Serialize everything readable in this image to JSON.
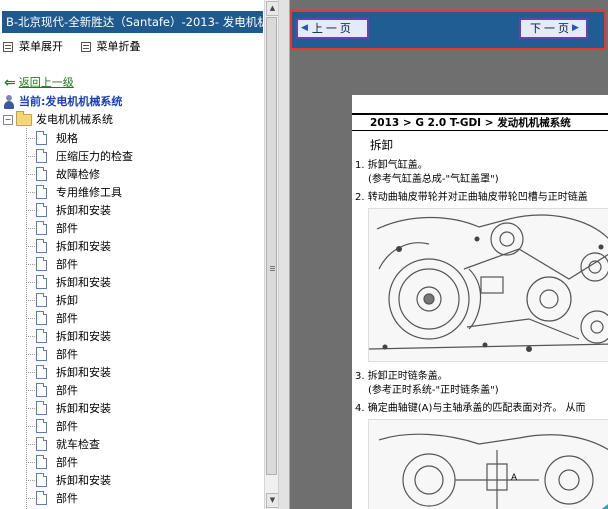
{
  "left": {
    "title": "B-北京现代-全新胜达（Santafe）-2013- 发电机机",
    "menu": {
      "expand": "菜单展开",
      "collapse": "菜单折叠"
    },
    "back_label": "返回上一级",
    "current_label": "当前:发电机机械系统",
    "tree_root": {
      "expander": "−",
      "label": "发电机机械系统"
    },
    "items": [
      "规格",
      "压缩压力的检查",
      "故障检修",
      "专用维修工具",
      "拆卸和安装",
      "部件",
      "拆卸和安装",
      "部件",
      "拆卸和安装",
      "拆卸",
      "部件",
      "拆卸和安装",
      "部件",
      "拆卸和安装",
      "部件",
      "拆卸和安装",
      "部件",
      "就车检查",
      "部件",
      "拆卸和安装",
      "部件"
    ]
  },
  "nav": {
    "prev": "上一页",
    "next": "下一页"
  },
  "document": {
    "breadcrumb": "2013 > G 2.0 T-GDI > 发动机机械系统",
    "section": "拆卸",
    "steps": [
      "1. 拆卸气缸盖。",
      "   (参考气缸盖总成-\"气缸盖罩\")",
      "2. 转动曲轴皮带轮并对正曲轴皮带轮凹槽与正时链盖",
      "3. 拆卸正时链条盖。",
      "   (参考正时系统-\"正时链条盖\")",
      "4. 确定曲轴键(A)与主轴承盖的匹配表面对齐。 从而"
    ],
    "figure_label": "A"
  },
  "colors": {
    "titlebar": "#1f5a8f",
    "navbar": "#1f5d93",
    "nav_border": "#e33333",
    "link": "#1b7a1b",
    "current": "#1a3fb0"
  }
}
